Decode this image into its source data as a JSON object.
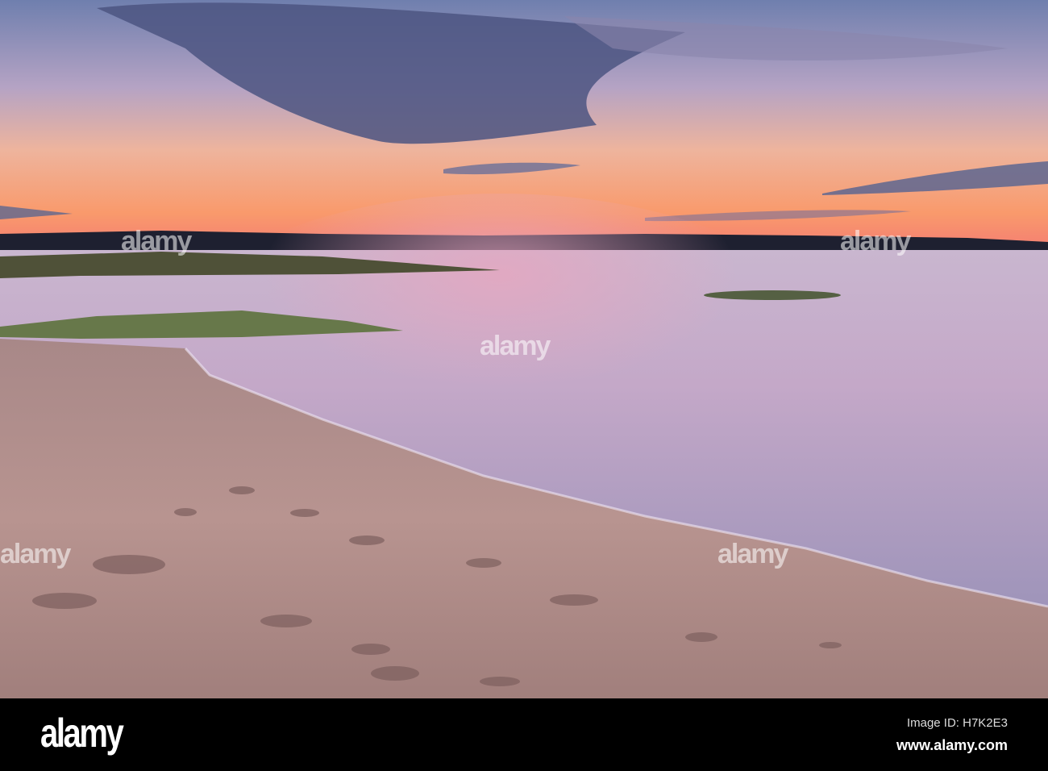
{
  "footer": {
    "logo": "alamy",
    "image_id": "Image ID: H7K2E3",
    "url": "www.alamy.com"
  },
  "watermark": "alamy",
  "colors": {
    "sky_top": "#5a6a9a",
    "horizon": "#f59a6a",
    "water": "#b9a9c9",
    "sand": "#b8938f",
    "footer_bg": "#000000"
  }
}
